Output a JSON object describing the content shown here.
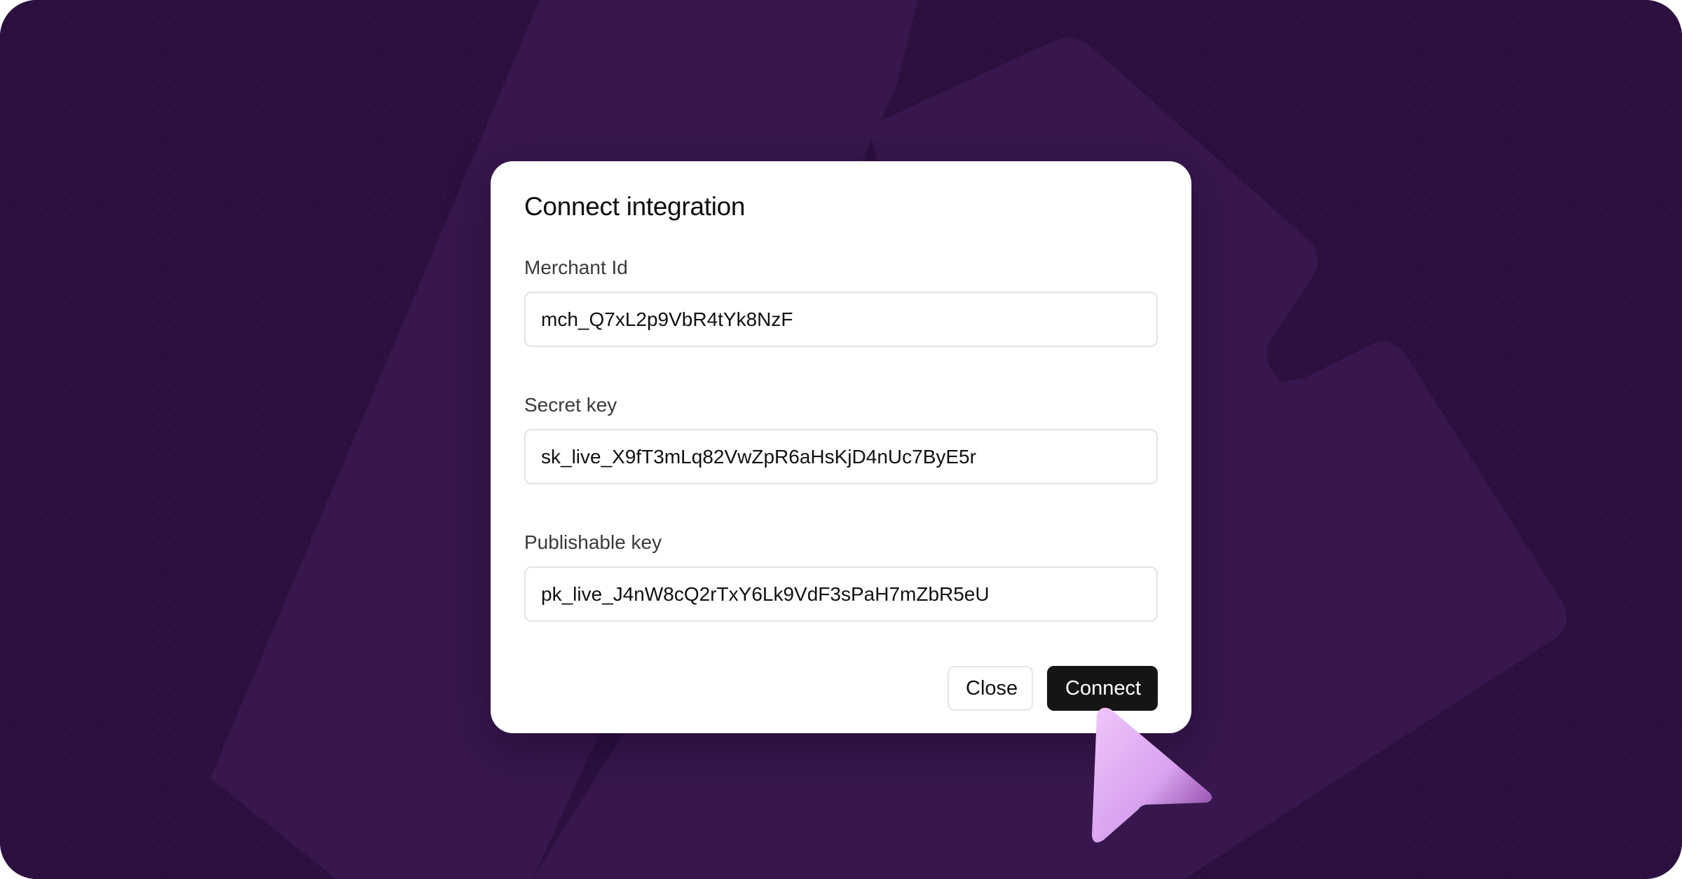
{
  "dialog": {
    "title": "Connect integration",
    "fields": [
      {
        "label": "Merchant Id",
        "value": "mch_Q7xL2p9VbR4tYk8NzF"
      },
      {
        "label": "Secret key",
        "value": "sk_live_X9fT3mLq82VwZpR6aHsKjD4nUc7ByE5r"
      },
      {
        "label": "Publishable key",
        "value": "pk_live_J4nW8cQ2rTxY6Lk9VdF3sPaH7mZbR5eU"
      }
    ],
    "buttons": {
      "close_label": "Close",
      "connect_label": "Connect"
    }
  },
  "colors": {
    "background": "#2b103f",
    "shape": "#37174d",
    "primary_button": "#151515",
    "cursor": "#e3b3f5"
  },
  "icons": {
    "cursor": "pointer-cursor-icon"
  }
}
